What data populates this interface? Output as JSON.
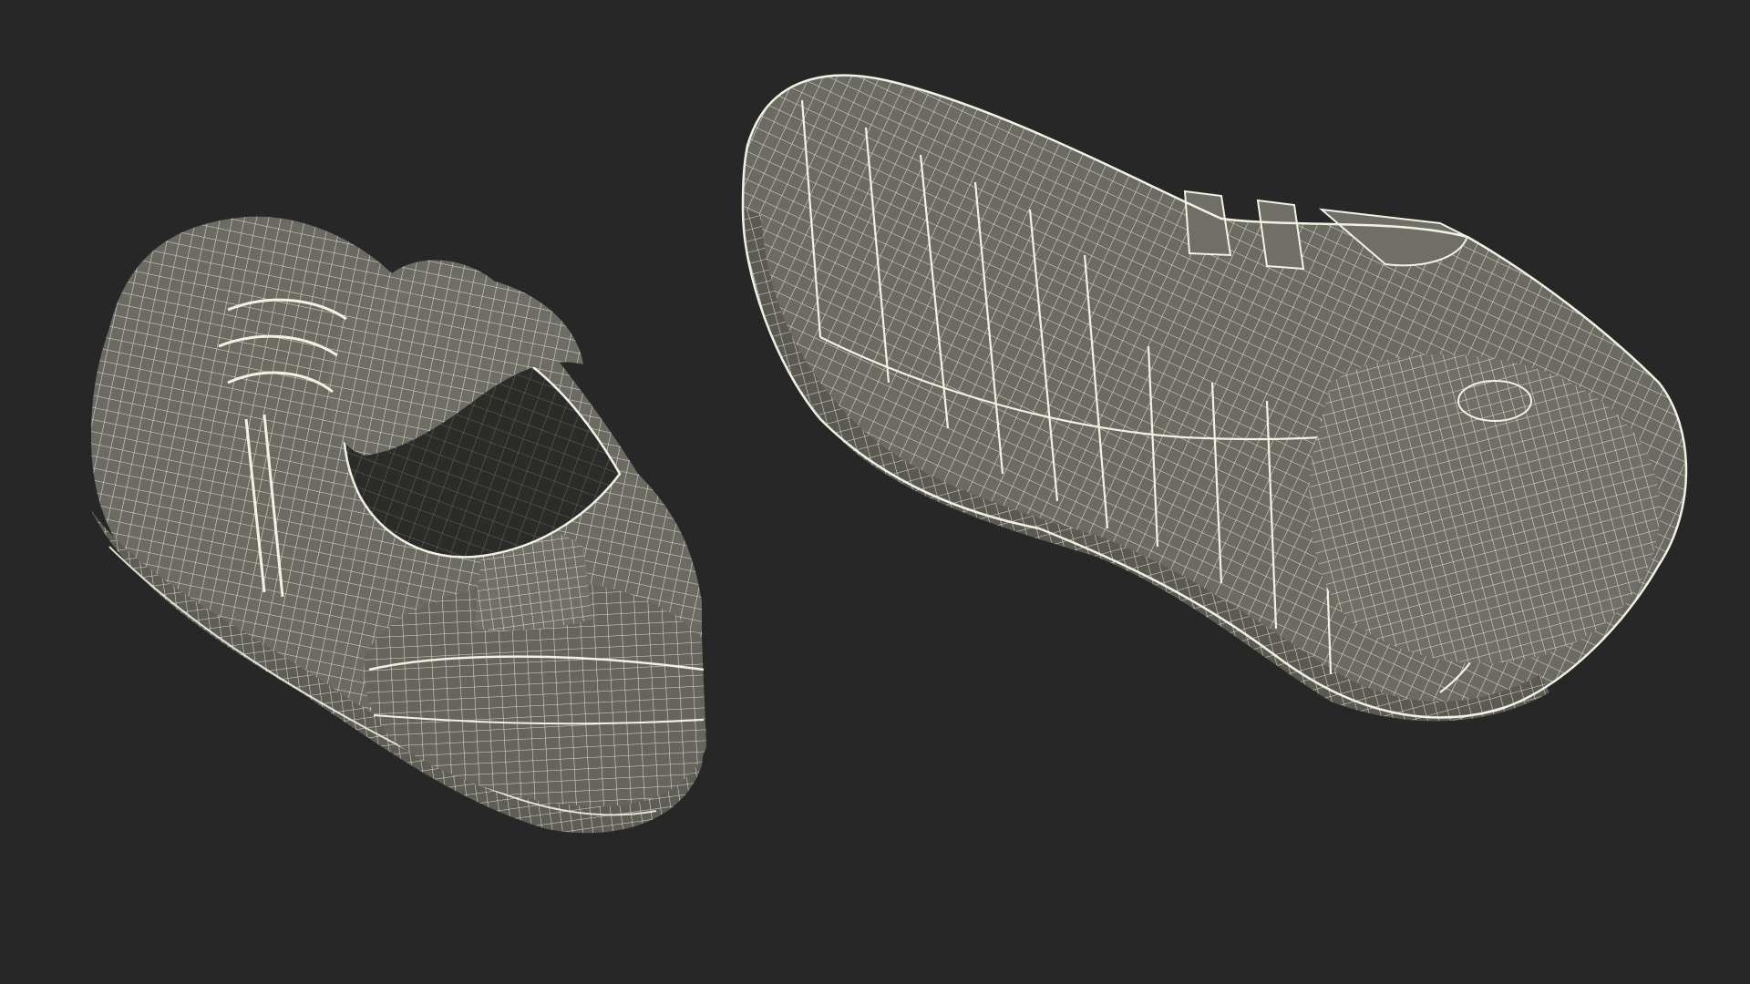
{
  "scene": {
    "background_color": "#272727",
    "mesh_fill_color": "#6b6b63",
    "mesh_fill_dark": "#4d4d47",
    "wire_color": "#f1f1e4",
    "interior_color": "#2b2b29",
    "objects": [
      {
        "name": "sneaker-rear-view",
        "description_icon": "sneaker-wireframe-icon"
      },
      {
        "name": "sneaker-sole-view",
        "description_icon": "sneaker-wireframe-icon"
      }
    ]
  }
}
